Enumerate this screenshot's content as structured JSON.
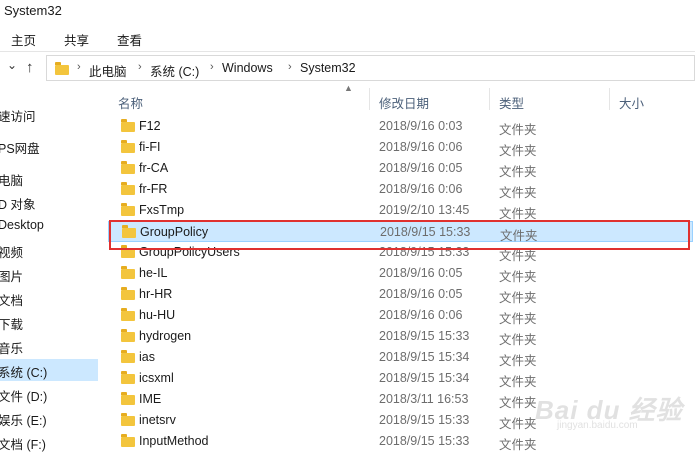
{
  "window": {
    "title": "System32"
  },
  "ribbon": {
    "tabs": [
      "主页",
      "共享",
      "查看"
    ]
  },
  "nav": {
    "dropdown_glyph": "⌄",
    "up_glyph": "↑"
  },
  "address": {
    "crumbs": [
      "此电脑",
      "系统 (C:)",
      "Windows",
      "System32"
    ],
    "separator": "›"
  },
  "sidebar": {
    "items": [
      {
        "label": "速访问"
      },
      {
        "label": "PS网盘"
      },
      {
        "label": "电脑"
      },
      {
        "label": "D 对象"
      },
      {
        "label": "Desktop"
      },
      {
        "label": "视频"
      },
      {
        "label": "图片"
      },
      {
        "label": "文档"
      },
      {
        "label": "下载"
      },
      {
        "label": "音乐"
      },
      {
        "label": "系统 (C:)",
        "selected": true
      },
      {
        "label": "文件 (D:)"
      },
      {
        "label": "娱乐 (E:)"
      },
      {
        "label": "文档 (F:)"
      }
    ]
  },
  "columns": {
    "name": "名称",
    "date": "修改日期",
    "type": "类型",
    "size": "大小"
  },
  "files": [
    {
      "name": "F12",
      "date": "2018/9/16 0:03",
      "type": "文件夹"
    },
    {
      "name": "fi-FI",
      "date": "2018/9/16 0:06",
      "type": "文件夹"
    },
    {
      "name": "fr-CA",
      "date": "2018/9/16 0:05",
      "type": "文件夹"
    },
    {
      "name": "fr-FR",
      "date": "2018/9/16 0:06",
      "type": "文件夹"
    },
    {
      "name": "FxsTmp",
      "date": "2019/2/10 13:45",
      "type": "文件夹"
    },
    {
      "name": "GroupPolicy",
      "date": "2018/9/15 15:33",
      "type": "文件夹",
      "selected": true
    },
    {
      "name": "GroupPolicyUsers",
      "date": "2018/9/15 15:33",
      "type": "文件夹"
    },
    {
      "name": "he-IL",
      "date": "2018/9/16 0:05",
      "type": "文件夹"
    },
    {
      "name": "hr-HR",
      "date": "2018/9/16 0:05",
      "type": "文件夹"
    },
    {
      "name": "hu-HU",
      "date": "2018/9/16 0:06",
      "type": "文件夹"
    },
    {
      "name": "hydrogen",
      "date": "2018/9/15 15:33",
      "type": "文件夹"
    },
    {
      "name": "ias",
      "date": "2018/9/15 15:34",
      "type": "文件夹"
    },
    {
      "name": "icsxml",
      "date": "2018/9/15 15:34",
      "type": "文件夹"
    },
    {
      "name": "IME",
      "date": "2018/3/11 16:53",
      "type": "文件夹"
    },
    {
      "name": "inetsrv",
      "date": "2018/9/15 15:33",
      "type": "文件夹"
    },
    {
      "name": "InputMethod",
      "date": "2018/9/15 15:33",
      "type": "文件夹"
    }
  ],
  "watermark": {
    "main": "Bai du 经验",
    "sub": "jingyan.baidu.com"
  },
  "colors": {
    "selection": "#cce8ff",
    "highlight_border": "#e0312f",
    "folder": "#f3c53d"
  }
}
